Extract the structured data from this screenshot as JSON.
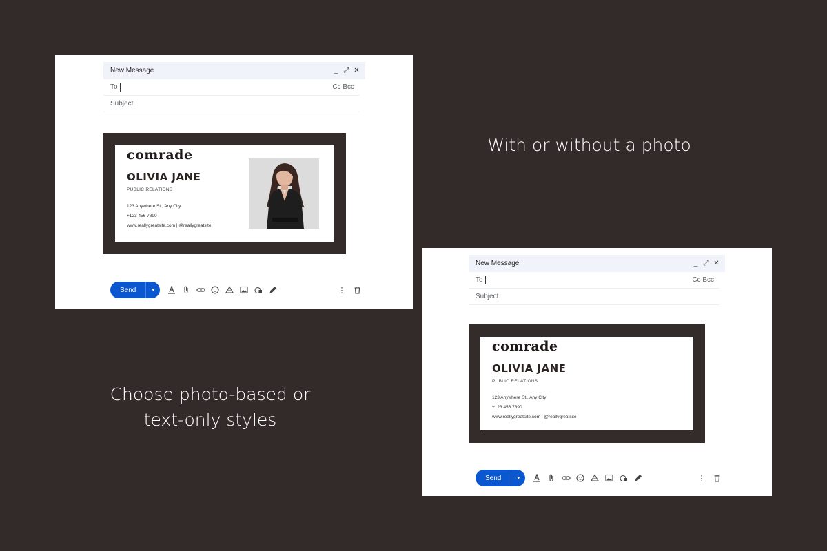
{
  "captions": {
    "with_or_without": "With or without a photo",
    "choose_line1": "Choose photo-based or",
    "choose_line2": "text-only styles"
  },
  "compose": {
    "title": "New Message",
    "to_label": "To",
    "cc_bcc": "Cc Bcc",
    "subject_placeholder": "Subject",
    "send_label": "Send",
    "window_controls": [
      "minimize-icon",
      "expand-icon",
      "close-icon"
    ],
    "toolbar_icons": [
      "formatting-icon",
      "attach-icon",
      "link-icon",
      "emoji-icon",
      "drive-icon",
      "photo-icon",
      "lock-timer-icon",
      "signature-pen-icon"
    ],
    "right_icons": [
      "more-options-icon",
      "trash-icon"
    ]
  },
  "signature": {
    "logo": "comrade",
    "name": "OLIVIA JANE",
    "role": "PUBLIC RELATIONS",
    "address": "123 Anywhere St., Any City",
    "phone": "+123 456 7890",
    "web": "www.reallygreatsite.com | @reallygreatsite"
  },
  "colors": {
    "background": "#332b29",
    "send_button": "#0b57d0",
    "signature_frame": "#342c2a"
  }
}
